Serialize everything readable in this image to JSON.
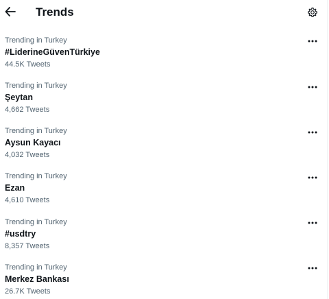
{
  "header": {
    "title": "Trends",
    "back_icon": "arrow-left-icon",
    "settings_icon": "gear-icon"
  },
  "trends": [
    {
      "context": "Trending in Turkey",
      "name": "#LiderineGüvenTürkiye",
      "count": "44.5K Tweets"
    },
    {
      "context": "Trending in Turkey",
      "name": "Şeytan",
      "count": "4,662 Tweets"
    },
    {
      "context": "Trending in Turkey",
      "name": "Aysun Kayacı",
      "count": "4,032 Tweets"
    },
    {
      "context": "Trending in Turkey",
      "name": "Ezan",
      "count": "4,610 Tweets"
    },
    {
      "context": "Trending in Turkey",
      "name": "#usdtry",
      "count": "8,357 Tweets"
    },
    {
      "context": "Trending in Turkey",
      "name": "Merkez Bankası",
      "count": "26.7K Tweets"
    }
  ],
  "colors": {
    "primary_text": "#0f1419",
    "secondary_text": "#536471",
    "background": "#ffffff"
  }
}
